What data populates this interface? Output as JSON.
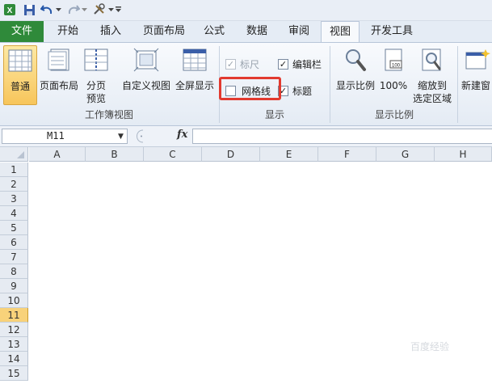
{
  "quick_access": {
    "icons": [
      "excel-logo-icon",
      "save-icon",
      "undo-icon",
      "redo-icon",
      "customize-icon"
    ]
  },
  "tabs": [
    {
      "label": "文件",
      "kind": "file"
    },
    {
      "label": "开始"
    },
    {
      "label": "插入"
    },
    {
      "label": "页面布局"
    },
    {
      "label": "公式"
    },
    {
      "label": "数据"
    },
    {
      "label": "审阅"
    },
    {
      "label": "视图",
      "active": true
    },
    {
      "label": "开发工具"
    }
  ],
  "ribbon": {
    "workbook_views": {
      "group_label": "工作簿视图",
      "normal": "普通",
      "page_layout": "页面布局",
      "page_break_1": "分页",
      "page_break_2": "预览",
      "custom_views": "自定义视图",
      "full_screen": "全屏显示"
    },
    "show": {
      "group_label": "显示",
      "ruler": "标尺",
      "formula_bar": "编辑栏",
      "gridlines": "网格线",
      "headings": "标题",
      "ruler_checked": true,
      "formula_bar_checked": true,
      "gridlines_checked": false,
      "headings_checked": true
    },
    "zoom": {
      "group_label": "显示比例",
      "zoom": "显示比例",
      "hundred": "100%",
      "zoom_selection_1": "缩放到",
      "zoom_selection_2": "选定区域"
    },
    "window": {
      "new_window": "新建窗"
    }
  },
  "formula_bar": {
    "name_box": "M11",
    "fx": "fx",
    "formula": ""
  },
  "sheet": {
    "columns": [
      "A",
      "B",
      "C",
      "D",
      "E",
      "F",
      "G",
      "H"
    ],
    "rows": [
      "1",
      "2",
      "3",
      "4",
      "5",
      "6",
      "7",
      "8",
      "9",
      "10",
      "11",
      "12",
      "13",
      "14",
      "15"
    ],
    "active_row": "11"
  },
  "watermark": "百度经验"
}
